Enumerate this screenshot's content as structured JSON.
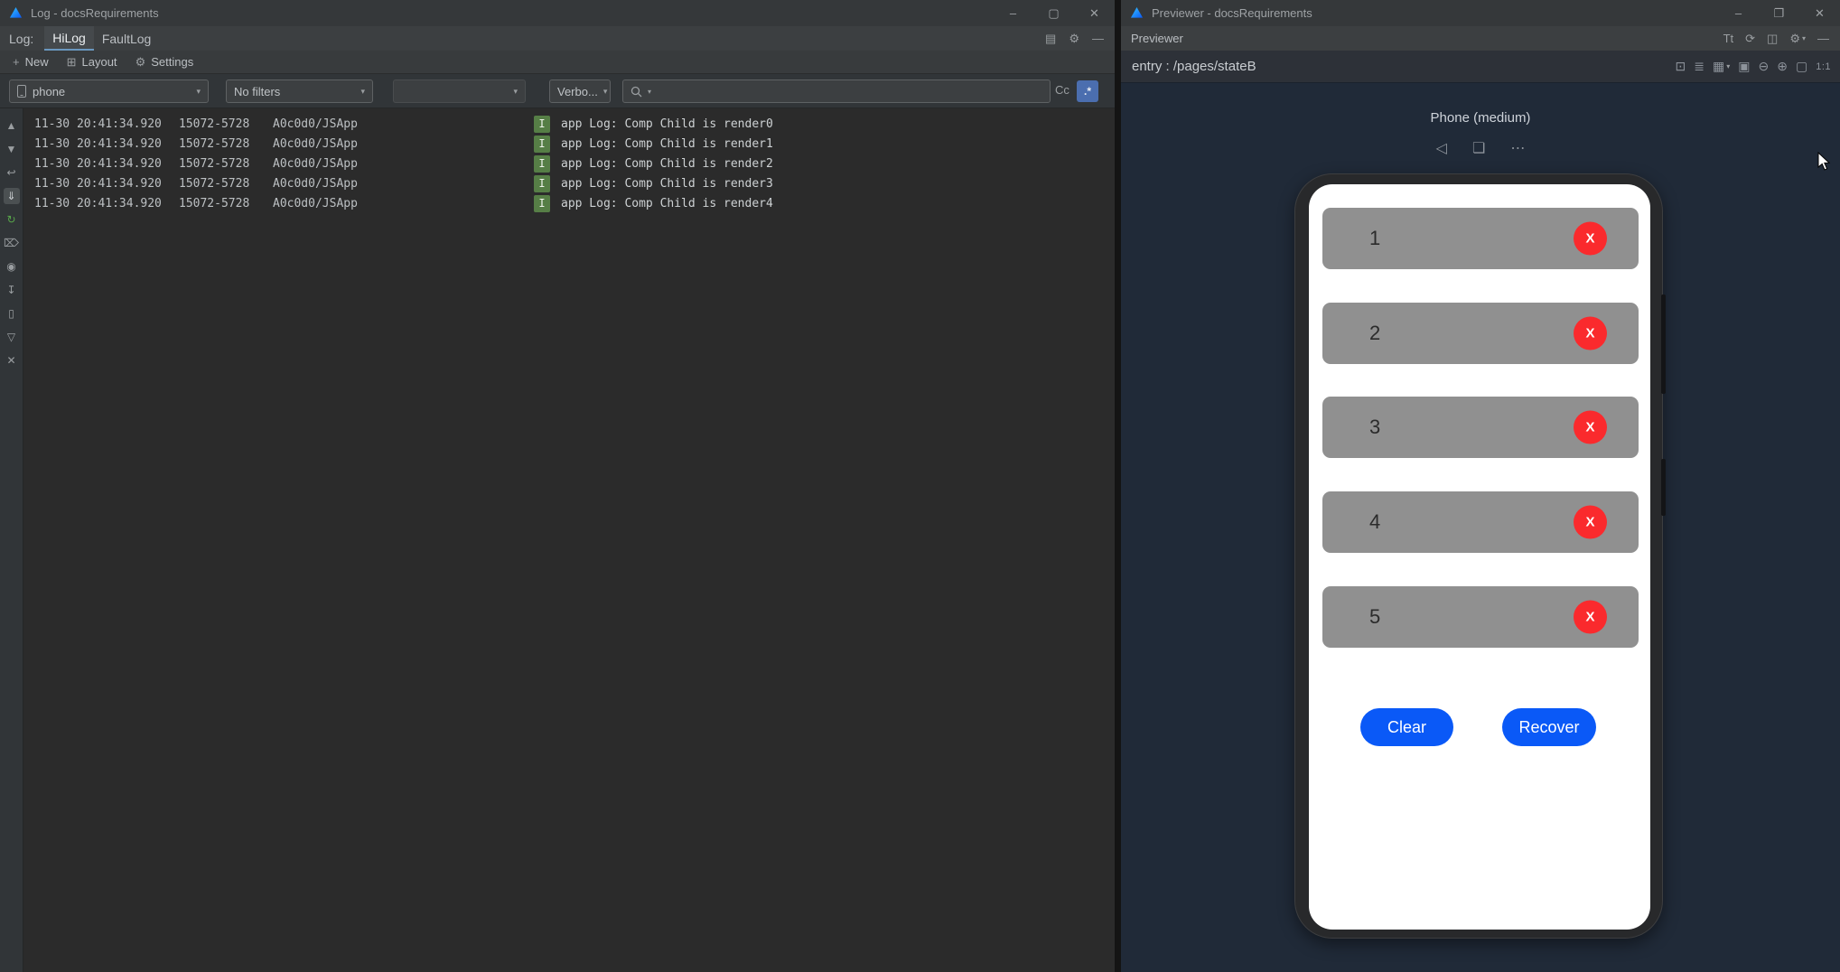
{
  "left_window": {
    "title": "Log - docsRequirements",
    "menu": {
      "log_label": "Log:",
      "tab_hilog": "HiLog",
      "tab_faultlog": "FaultLog"
    },
    "toolbar": {
      "new_label": "New",
      "layout_label": "Layout",
      "settings_label": "Settings"
    },
    "filter_bar": {
      "device_select": "phone",
      "filter_select": "No filters",
      "level_select": "Verbo...",
      "match_case": "Cc"
    },
    "log_rows": [
      {
        "time": "11-30 20:41:34.920",
        "pid_tid": "15072-5728",
        "tag": "A0c0d0/JSApp",
        "level": "I",
        "message": "app Log: Comp Child is render0"
      },
      {
        "time": "11-30 20:41:34.920",
        "pid_tid": "15072-5728",
        "tag": "A0c0d0/JSApp",
        "level": "I",
        "message": "app Log: Comp Child is render1"
      },
      {
        "time": "11-30 20:41:34.920",
        "pid_tid": "15072-5728",
        "tag": "A0c0d0/JSApp",
        "level": "I",
        "message": "app Log: Comp Child is render2"
      },
      {
        "time": "11-30 20:41:34.920",
        "pid_tid": "15072-5728",
        "tag": "A0c0d0/JSApp",
        "level": "I",
        "message": "app Log: Comp Child is render3"
      },
      {
        "time": "11-30 20:41:34.920",
        "pid_tid": "15072-5728",
        "tag": "A0c0d0/JSApp",
        "level": "I",
        "message": "app Log: Comp Child is render4"
      }
    ]
  },
  "right_window": {
    "title": "Previewer - docsRequirements",
    "panel_label": "Previewer",
    "entry_path": "entry : /pages/stateB",
    "zoom_ratio": "1:1",
    "device_label": "Phone (medium)",
    "list_items": [
      {
        "number": "1",
        "close": "X"
      },
      {
        "number": "2",
        "close": "X"
      },
      {
        "number": "3",
        "close": "X"
      },
      {
        "number": "4",
        "close": "X"
      },
      {
        "number": "5",
        "close": "X"
      }
    ],
    "clear_button": "Clear",
    "recover_button": "Recover"
  },
  "icons": {
    "minimize": "–",
    "maximize": "▢",
    "restore": "❐",
    "close": "✕",
    "panel_layout": "▤",
    "gear": "⚙",
    "hide_panel": "—",
    "plus": "+",
    "grid": "⊞",
    "caret": "▾",
    "regex": ".*",
    "scroll_up": "▲",
    "scroll_down": "▼",
    "soft_wrap": "↩",
    "scroll_end": "⇓",
    "restart": "↻",
    "clear_all": "⌦",
    "screenshot": "◉",
    "export_log": "↧",
    "device": "▯",
    "filter": "▽",
    "close_small": "✕",
    "font_size": "Tt",
    "refresh": "⟳",
    "inspector": "◫",
    "preview_mode": "⊡",
    "layers": "≣",
    "grid_view": "▦",
    "frame": "▣",
    "zoom_out": "⊖",
    "zoom_in": "⊕",
    "fit_screen": "▢",
    "back": "◁",
    "pages": "❏",
    "more": "⋯"
  },
  "colors": {
    "accent_blue": "#0a59f7",
    "delete_red": "#fa2a2d",
    "log_info_green": "#567e46",
    "row_gray": "#909090",
    "preview_background": "#202a38"
  }
}
